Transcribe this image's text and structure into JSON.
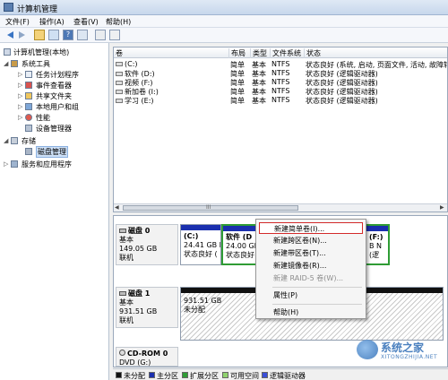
{
  "window": {
    "title": "计算机管理"
  },
  "menu": [
    "文件(F)",
    "操作(A)",
    "查看(V)",
    "帮助(H)"
  ],
  "tree": {
    "root": "计算机管理(本地)",
    "system_tools": "系统工具",
    "task_scheduler": "任务计划程序",
    "event_viewer": "事件查看器",
    "shared_folders": "共享文件夹",
    "local_users": "本地用户和组",
    "performance": "性能",
    "device_manager": "设备管理器",
    "storage": "存储",
    "disk_management": "磁盘管理",
    "services_apps": "服务和应用程序"
  },
  "volume_table": {
    "headers": [
      "卷",
      "布局",
      "类型",
      "文件系统",
      "状态"
    ],
    "rows": [
      [
        "(C:)",
        "简单",
        "基本",
        "NTFS",
        "状态良好 (系统, 启动, 页面文件, 活动, 故障转储"
      ],
      [
        "软件 (D:)",
        "简单",
        "基本",
        "NTFS",
        "状态良好 (逻辑驱动器)"
      ],
      [
        "视频 (F:)",
        "简单",
        "基本",
        "NTFS",
        "状态良好 (逻辑驱动器)"
      ],
      [
        "新加卷 (I:)",
        "简单",
        "基本",
        "NTFS",
        "状态良好 (逻辑驱动器)"
      ],
      [
        "学习 (E:)",
        "简单",
        "基本",
        "NTFS",
        "状态良好 (逻辑驱动器)"
      ]
    ],
    "scroll_grip": "III"
  },
  "disks": {
    "disk0": {
      "name": "磁盘 0",
      "type": "基本",
      "size": "149.05 GB",
      "status": "联机",
      "parts": [
        {
          "name": "(C:)",
          "line2": "24.41 GB I",
          "line3": "状态良好 ("
        },
        {
          "name": "软件 (D",
          "line2": "24.00 GB",
          "line3": "状态良好"
        },
        {
          "name": "(F:)",
          "line2": "B N",
          "line3": "(逻"
        }
      ]
    },
    "disk1": {
      "name": "磁盘 1",
      "type": "基本",
      "size": "931.51 GB",
      "status": "联机",
      "unalloc_size": "931.51 GB",
      "unalloc_label": "未分配"
    },
    "cdrom": {
      "name": "CD-ROM 0",
      "drive": "DVD (G:)"
    }
  },
  "legend": [
    {
      "label": "未分配",
      "color": "#111111"
    },
    {
      "label": "主分区",
      "color": "#1a2fae"
    },
    {
      "label": "扩展分区",
      "color": "#2f9c35"
    },
    {
      "label": "可用空间",
      "color": "#8fd26e"
    },
    {
      "label": "逻辑驱动器",
      "color": "#3b4fd8"
    }
  ],
  "context_menu": {
    "items": [
      {
        "label": "新建简单卷(I)...",
        "state": "highlight"
      },
      {
        "label": "新建跨区卷(N)...",
        "state": "normal"
      },
      {
        "label": "新建带区卷(T)...",
        "state": "normal"
      },
      {
        "label": "新建镜像卷(R)...",
        "state": "normal"
      },
      {
        "label": "新建 RAID-5 卷(W)...",
        "state": "disabled"
      },
      {
        "label": "属性(P)",
        "state": "normal"
      },
      {
        "label": "帮助(H)",
        "state": "normal"
      }
    ]
  },
  "toolbar_icons": {
    "help": "?"
  },
  "watermark": {
    "text": "系统之家",
    "sub": "XITONGZHIJIA.NET"
  }
}
